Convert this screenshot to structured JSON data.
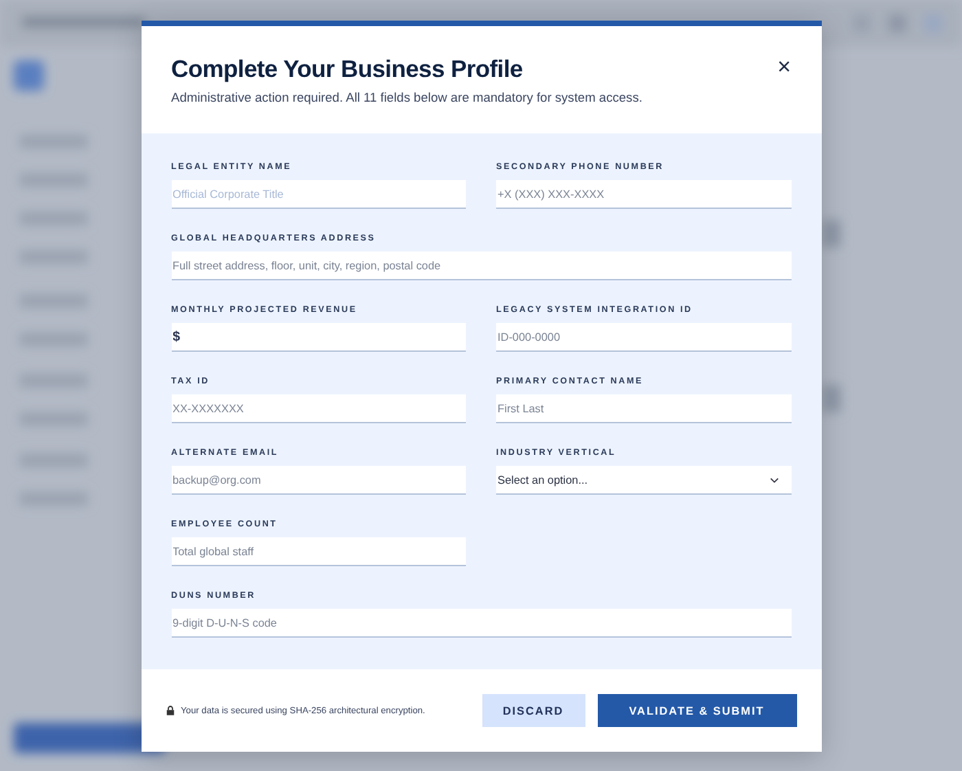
{
  "dialog": {
    "title": "Complete Your Business Profile",
    "subtitle": "Administrative action required. All 11 fields below are mandatory for system access.",
    "close": "×"
  },
  "fields": [
    {
      "label": "LEGAL ENTITY NAME",
      "kind": "text",
      "wide": false,
      "faint": true,
      "placeholder": "Official Corporate Title"
    },
    {
      "label": "SECONDARY PHONE NUMBER",
      "kind": "text",
      "wide": false,
      "placeholder": "+X (XXX) XXX-XXXX"
    },
    {
      "label": "GLOBAL HEADQUARTERS ADDRESS",
      "kind": "text",
      "wide": true,
      "placeholder": "Full street address, floor, unit, city, region, postal code"
    },
    {
      "label": "MONTHLY PROJECTED REVENUE",
      "kind": "text",
      "wide": false,
      "value": "$"
    },
    {
      "label": "LEGACY SYSTEM INTEGRATION ID",
      "kind": "text",
      "wide": false,
      "placeholder": "ID-000-0000"
    },
    {
      "label": "TAX ID",
      "kind": "text",
      "wide": false,
      "placeholder": "XX-XXXXXXX"
    },
    {
      "label": "PRIMARY CONTACT NAME",
      "kind": "text",
      "wide": false,
      "placeholder": "First Last"
    },
    {
      "label": "ALTERNATE EMAIL",
      "kind": "text",
      "wide": false,
      "placeholder": "backup@org.com"
    },
    {
      "label": "INDUSTRY VERTICAL",
      "kind": "select",
      "wide": false,
      "value": "Select an option..."
    },
    {
      "label": "EMPLOYEE COUNT",
      "kind": "text",
      "wide": false,
      "placeholder": "Total global staff"
    },
    {
      "label": "DUNS NUMBER",
      "kind": "text",
      "wide": true,
      "placeholder": "9-digit D-U-N-S code"
    }
  ],
  "footer": {
    "note": "Your data is secured using SHA-256 architectural encryption.",
    "buttons": [
      {
        "label": "DISCARD",
        "kind": "secondary"
      },
      {
        "label": "VALIDATE & SUBMIT",
        "kind": "primary"
      }
    ]
  }
}
